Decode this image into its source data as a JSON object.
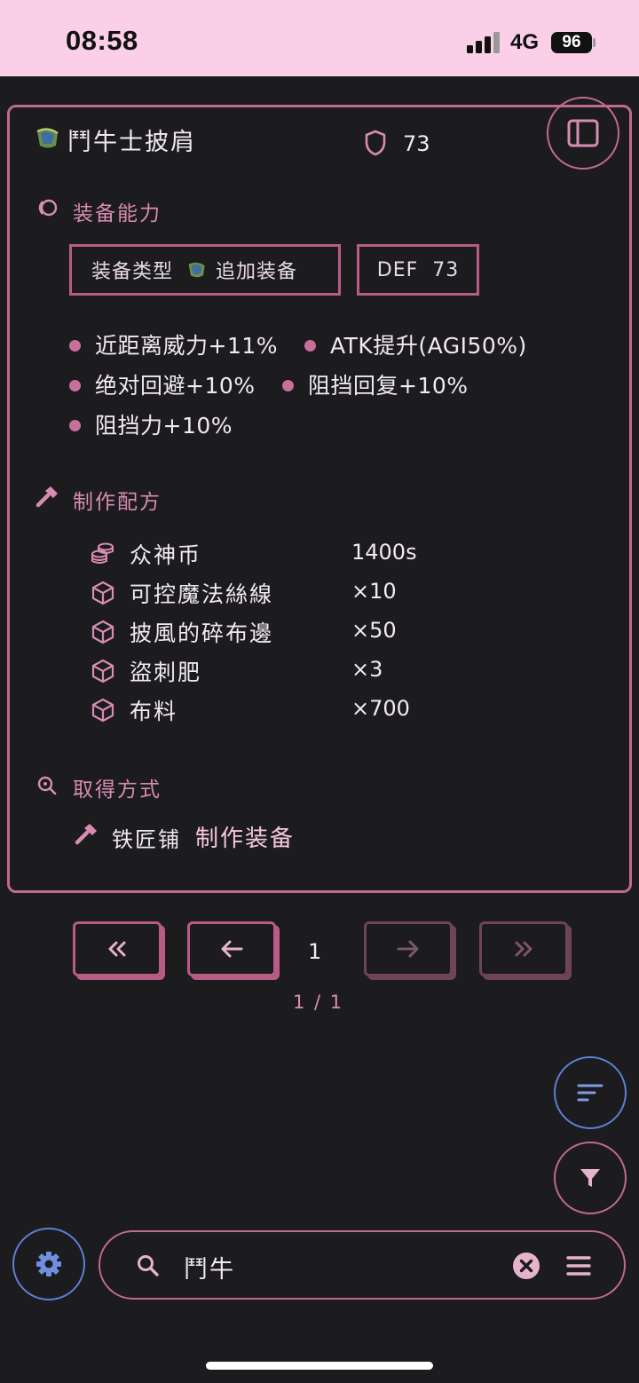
{
  "status": {
    "time": "08:58",
    "network": "4G",
    "battery": "96"
  },
  "item": {
    "name": "鬥牛士披肩",
    "def": "73"
  },
  "ability": {
    "title": "装备能力",
    "type_label": "装备类型",
    "type_value": "追加装备",
    "def_chip": "DEF  73",
    "effects": [
      "近距离威力+11%",
      "ATK提升(AGI50%)",
      "绝对回避+10%",
      "阻挡回复+10%",
      "阻挡力+10%"
    ]
  },
  "recipe": {
    "title": "制作配方",
    "rows": [
      {
        "icon": "coins-icon",
        "name": "众神币",
        "qty": "1400s"
      },
      {
        "icon": "cube-icon",
        "name": "可控魔法絲線",
        "qty": "×10"
      },
      {
        "icon": "cube-icon",
        "name": "披風的碎布邊",
        "qty": "×50"
      },
      {
        "icon": "cube-icon",
        "name": "盜刺肥",
        "qty": "×3"
      },
      {
        "icon": "cube-icon",
        "name": "布料",
        "qty": "×700"
      }
    ]
  },
  "obtain": {
    "title": "取得方式",
    "place": "铁匠铺",
    "method": "制作装备"
  },
  "pager": {
    "current": "1",
    "summary": "1 / 1"
  },
  "search": {
    "value": "鬥牛"
  },
  "colors": {
    "accent": "#c06a91",
    "blue_accent": "#5c7fd8",
    "status_bg": "#fbcfe8"
  }
}
